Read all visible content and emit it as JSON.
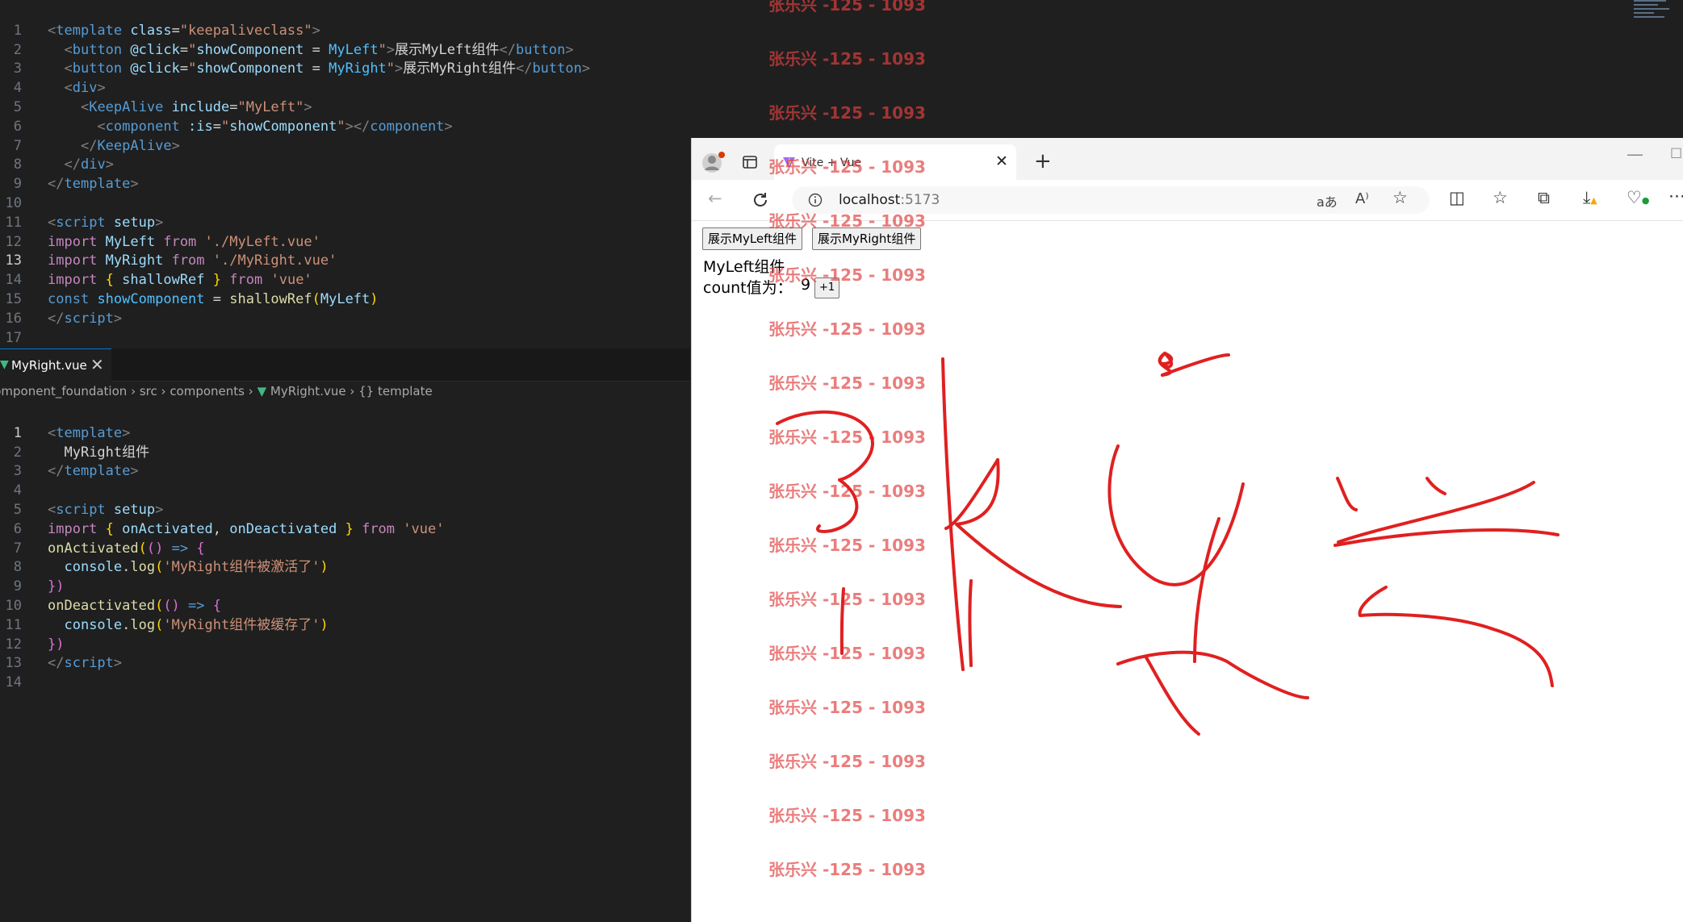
{
  "editor_top": {
    "lines": [
      {
        "n": "1"
      },
      {
        "n": "2"
      },
      {
        "n": "3"
      },
      {
        "n": "4"
      },
      {
        "n": "5"
      },
      {
        "n": "6"
      },
      {
        "n": "7"
      },
      {
        "n": "8"
      },
      {
        "n": "9"
      },
      {
        "n": "10"
      },
      {
        "n": "11"
      },
      {
        "n": "12"
      },
      {
        "n": "13"
      },
      {
        "n": "14"
      },
      {
        "n": "15"
      },
      {
        "n": "16"
      },
      {
        "n": "17"
      }
    ],
    "current_line": "13"
  },
  "editor_bottom": {
    "tab": {
      "label": "MyRight.vue",
      "close": "✕"
    },
    "breadcrumb": [
      "component_foundation",
      "src",
      "components",
      "MyRight.vue",
      "template"
    ],
    "current_line": "1"
  },
  "browser": {
    "tab_title": "Vite + Vue",
    "url_host": "localhost",
    "url_port": ":5173",
    "page": {
      "btn_left": "展示MyLeft组件",
      "btn_right": "展示MyRight组件",
      "component_title": "MyLeft组件",
      "count_label": "count值为：",
      "count_value": "9",
      "increment_label": "+1"
    }
  },
  "watermark": {
    "text": "张乐兴 -125 - 1093",
    "count": 17,
    "color": "#e04040"
  },
  "handwriting": {
    "text": "张乐兴",
    "color": "#e02020"
  }
}
